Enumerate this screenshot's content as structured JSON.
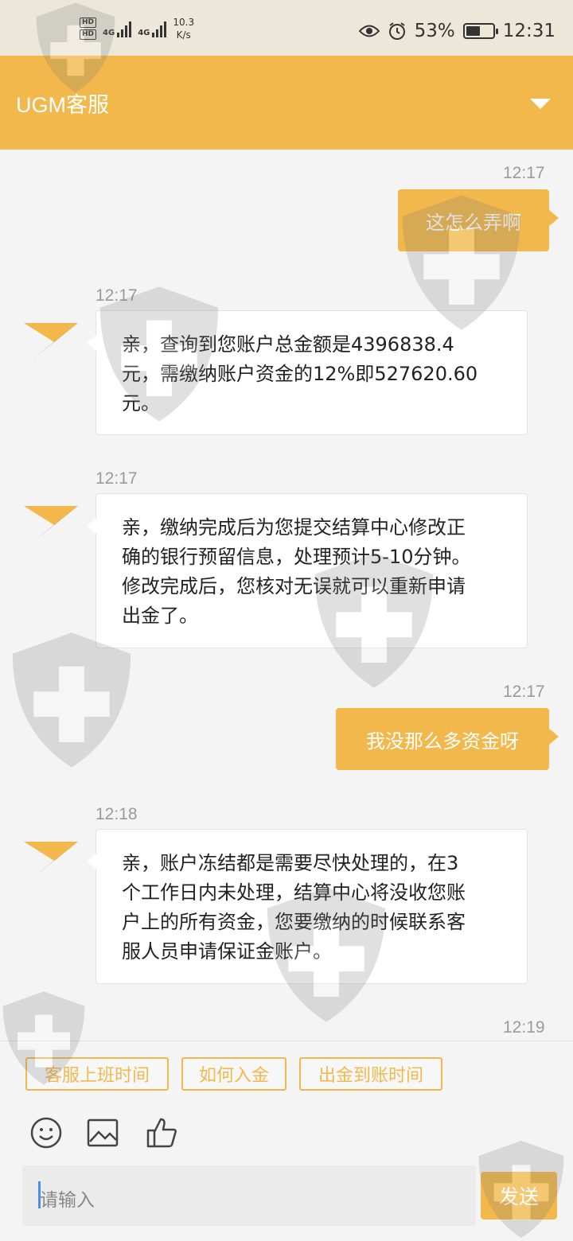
{
  "status_bar": {
    "hd1": "HD",
    "hd2": "HD",
    "net1": "4G",
    "net2": "4G",
    "speed_value": "10.3",
    "speed_unit": "K/s",
    "battery_percent": "53%",
    "battery_level": 0.53,
    "time": "12:31",
    "icons": [
      "eye-icon",
      "alarm-icon",
      "battery-icon"
    ]
  },
  "header": {
    "title": "UGM客服",
    "menu_icon": "chevron-down-icon"
  },
  "chat": {
    "messages": [
      {
        "side": "out",
        "time": "12:17",
        "text": "这怎么弄啊"
      },
      {
        "side": "in",
        "time": "12:17",
        "lines": [
          "亲，查询到您账户总金额是4396838.4",
          "元，需缴纳账户资金的12%即527620.60",
          "元。"
        ]
      },
      {
        "side": "in",
        "time": "12:17",
        "lines": [
          "亲，缴纳完成后为您提交结算中心修改正",
          "确的银行预留信息，处理预计5-10分钟。",
          "修改完成后，您核对无误就可以重新申请",
          "出金了。"
        ]
      },
      {
        "side": "out",
        "time": "12:17",
        "text": "我没那么多资金呀"
      },
      {
        "side": "in",
        "time": "12:18",
        "lines": [
          "亲，账户冻结都是需要尽快处理的，在3",
          "个工作日内未处理，结算中心将没收您账",
          "户上的所有资金，您要缴纳的时候联系客",
          "服人员申请保证金账户。"
        ]
      }
    ],
    "last_time": "12:19"
  },
  "quick_replies": [
    "客服上班时间",
    "如何入金",
    "出金到账时间"
  ],
  "toolbar": {
    "icons": [
      "emoji-icon",
      "image-icon",
      "thumbs-up-icon"
    ]
  },
  "composer": {
    "placeholder": "请输入",
    "send_label": "发送"
  },
  "colors": {
    "accent": "#f2b84b",
    "status_bg": "#ece7d9",
    "chat_bg": "#f4f4f4"
  }
}
